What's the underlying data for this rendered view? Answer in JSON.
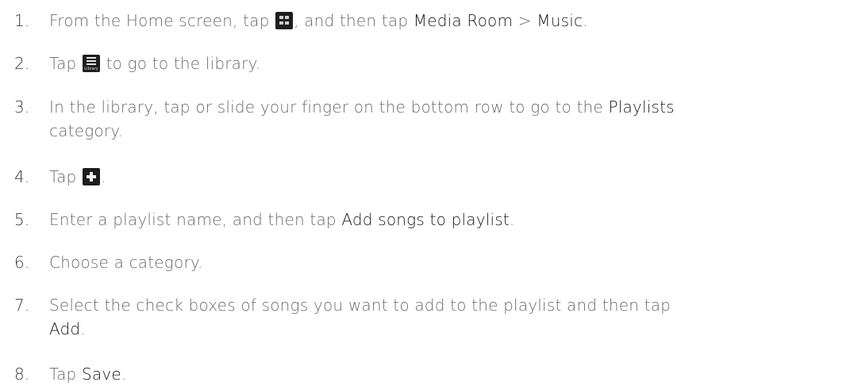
{
  "steps": [
    {
      "num": "1.",
      "t1": "From the Home screen, tap ",
      "t2": ", and then tap ",
      "b1": "Media Room",
      "t3": " > ",
      "b2": "Music",
      "t4": "."
    },
    {
      "num": "2.",
      "t1": "Tap ",
      "icon_label": "Library",
      "t2": " to go to the library."
    },
    {
      "num": "3.",
      "t1": "In the library, tap or slide your finger on the bottom row to go to the ",
      "b1": "Playlists",
      "t2": "category."
    },
    {
      "num": "4.",
      "t1": "Tap ",
      "t2": "."
    },
    {
      "num": "5.",
      "t1": "Enter a playlist name, and then tap ",
      "b1": "Add songs to playlist",
      "t2": "."
    },
    {
      "num": "6.",
      "t1": "Choose a category."
    },
    {
      "num": "7.",
      "t1": "Select the check boxes of songs you want to add to the playlist and then tap",
      "b1": "Add",
      "t2": "."
    },
    {
      "num": "8.",
      "t1": "Tap ",
      "b1": "Save",
      "t2": "."
    }
  ],
  "icons": {
    "apps": "apps-grid-icon",
    "library": "library-icon",
    "add": "plus-icon"
  }
}
